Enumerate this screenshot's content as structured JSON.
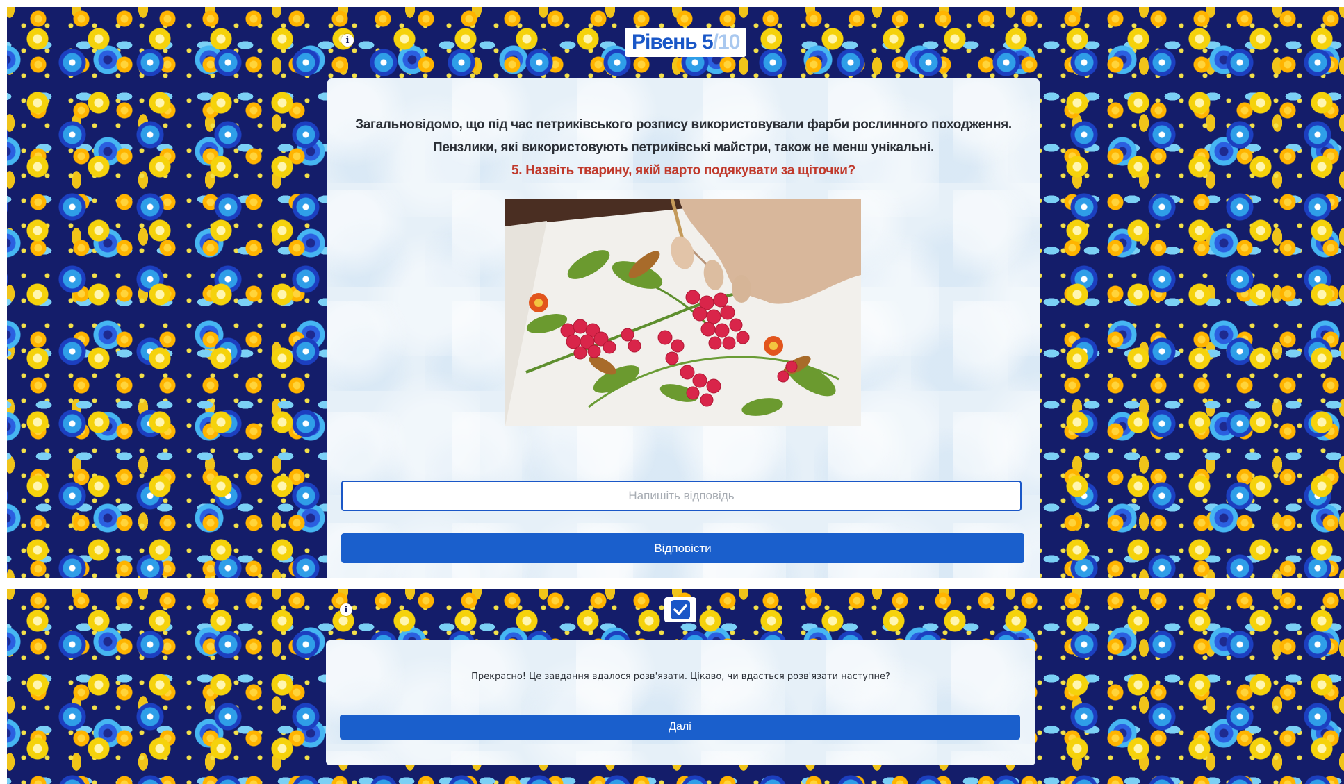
{
  "level": {
    "word": "Рівень",
    "current": "5",
    "separator": "/",
    "total": "10"
  },
  "question": {
    "line1": "Загальновідомо, що під час петриківського розпису використовували фарби рослинного походження.",
    "line2": "Пензлики, які використовують петриківські майстри, також не менш унікальні.",
    "ask": "5. Назвіть тварину, якій варто подякувати за щіточки?"
  },
  "answer": {
    "placeholder": "Напишіть відповідь",
    "value": ""
  },
  "buttons": {
    "answer_label": "Відповісти",
    "next_label": "Далі"
  },
  "result": {
    "message": "Прекрасно! Це завдання вдалося розв'язати. Цікаво, чи вдасться розв'язати наступне?"
  },
  "icons": {
    "info": "info-icon",
    "check": "checkmark-icon"
  },
  "colors": {
    "accent": "#1a57c7",
    "question_highlight": "#c0392b",
    "background": "#141d6a"
  }
}
